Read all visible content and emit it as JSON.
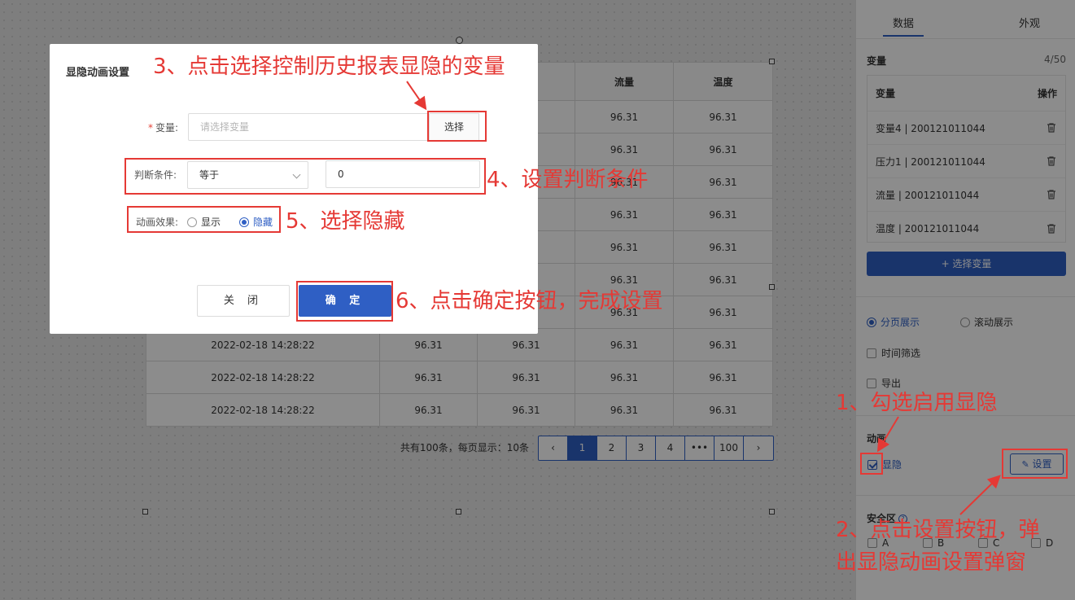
{
  "table": {
    "headers": [
      "",
      "",
      "",
      "流量",
      "温度"
    ],
    "rows": [
      [
        "",
        "",
        "",
        "96.31",
        "96.31"
      ],
      [
        "",
        "",
        "",
        "96.31",
        "96.31"
      ],
      [
        "",
        "",
        "",
        "96.31",
        "96.31"
      ],
      [
        "",
        "",
        "",
        "96.31",
        "96.31"
      ],
      [
        "",
        "",
        "",
        "96.31",
        "96.31"
      ],
      [
        "",
        "",
        "",
        "96.31",
        "96.31"
      ],
      [
        "",
        "",
        "",
        "96.31",
        "96.31"
      ],
      [
        "2022-02-18 14:28:22",
        "96.31",
        "96.31",
        "96.31",
        "96.31"
      ],
      [
        "2022-02-18 14:28:22",
        "96.31",
        "96.31",
        "96.31",
        "96.31"
      ],
      [
        "2022-02-18 14:28:22",
        "96.31",
        "96.31",
        "96.31",
        "96.31"
      ]
    ]
  },
  "pagination": {
    "total_text": "共有100条，每页显示：10条",
    "prev": "‹",
    "pages": [
      "1",
      "2",
      "3",
      "4",
      "•••",
      "100"
    ],
    "next": "›",
    "active": "1"
  },
  "right_panel": {
    "tabs": [
      "数据",
      "外观"
    ],
    "active_tab": "数据",
    "variables": {
      "title": "变量",
      "count": "4/50",
      "col_var": "变量",
      "col_op": "操作",
      "items": [
        "变量4 | 200121011044",
        "压力1 | 200121011044",
        "流量 | 200121011044",
        "温度 | 200121011044"
      ],
      "add_label": "+ 选择变量"
    },
    "display_modes": {
      "paged": "分页展示",
      "scroll": "滚动展示",
      "selected": "paged"
    },
    "time_filter": "时间筛选",
    "export": "导出",
    "animation": {
      "title": "动画",
      "visibility_label": "显隐",
      "checked": true,
      "setting_label": "设置"
    },
    "safe_zone": {
      "title": "安全区",
      "options": [
        "A",
        "B",
        "C",
        "D"
      ]
    }
  },
  "modal": {
    "title": "显隐动画设置",
    "variable_label": "变量:",
    "variable_placeholder": "请选择变量",
    "select_btn": "选择",
    "condition_label": "判断条件:",
    "condition_value": "等于",
    "condition_input": "0",
    "effect_label": "动画效果:",
    "effect_show": "显示",
    "effect_hide": "隐藏",
    "effect_selected": "隐藏",
    "close_btn": "关 闭",
    "ok_btn": "确 定"
  },
  "annotations": {
    "step1": "1、勾选启用显隐",
    "step2_line1": "2、点击设置按钮，弹",
    "step2_line2": "出显隐动画设置弹窗",
    "step3": "3、点击选择控制历史报表显隐的变量",
    "step4": "4、设置判断条件",
    "step5": "5、选择隐藏",
    "step6": "6、点击确定按钮，完成设置"
  },
  "colors": {
    "primary": "#2f5fc4",
    "annotation": "#e53935"
  }
}
